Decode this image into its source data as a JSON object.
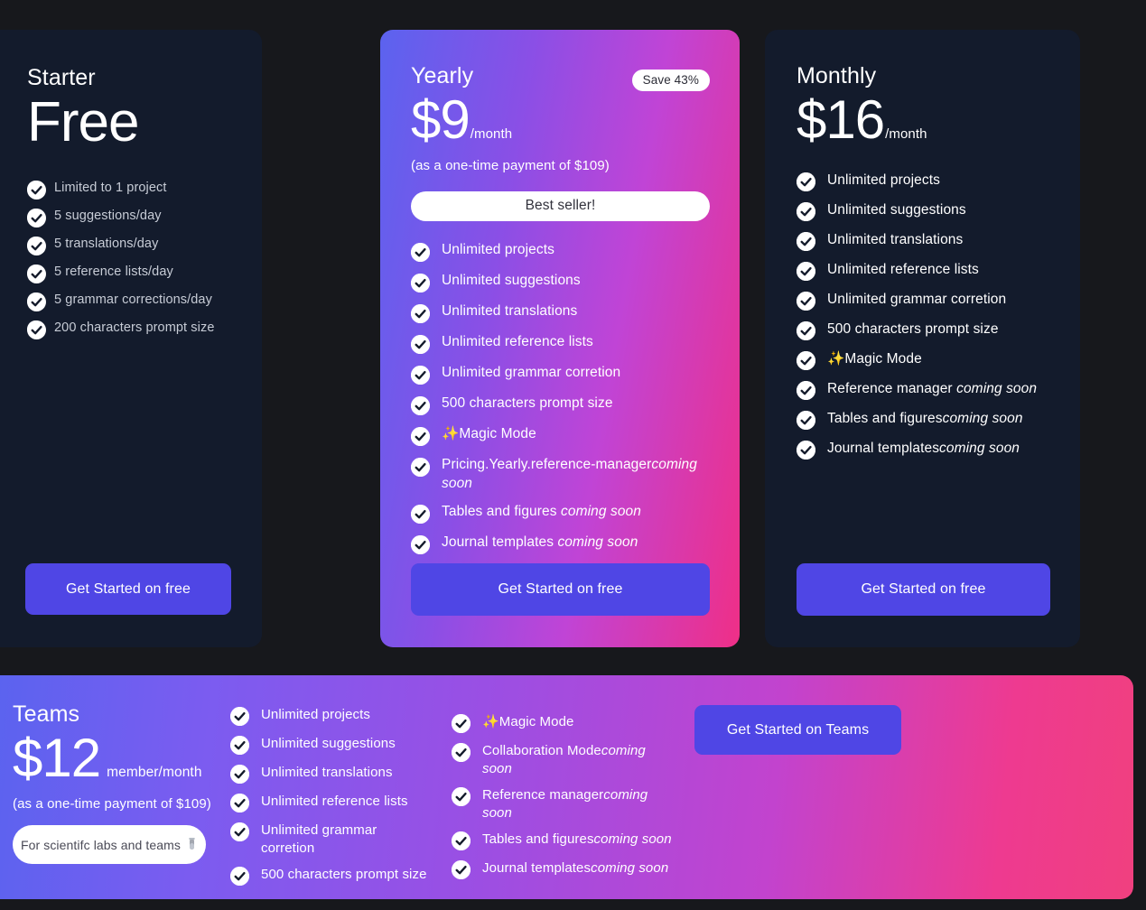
{
  "theme": {
    "page_background": "#17181c",
    "card_background": "#131b2c",
    "accent_button": "#4f46e5",
    "gradient_start": "#5b63ef",
    "gradient_end": "#ef2f87",
    "check_icon": "check-circle-icon"
  },
  "plans": [
    {
      "id": "starter",
      "name": "Starter",
      "price": "Free",
      "per": "",
      "note": "",
      "features": [
        {
          "label": "Limited to 1 project"
        },
        {
          "label": "5 suggestions/day"
        },
        {
          "label": "5 translations/day"
        },
        {
          "label": "5 reference lists/day"
        },
        {
          "label": "5 grammar corrections/day"
        },
        {
          "label": "200 characters prompt size"
        }
      ],
      "cta": "Get Started on free"
    },
    {
      "id": "yearly",
      "name": "Yearly",
      "price": "$9",
      "per": "/month",
      "note": "(as a one-time payment of $109)",
      "badge": "Save 43%",
      "pill": "Best seller!",
      "features": [
        {
          "label": "Unlimited projects"
        },
        {
          "label": "Unlimited suggestions"
        },
        {
          "label": "Unlimited translations"
        },
        {
          "label": "Unlimited reference lists"
        },
        {
          "label": "Unlimited grammar corretion"
        },
        {
          "label": "500 characters prompt size"
        },
        {
          "label": "✨Magic Mode"
        },
        {
          "label": "Pricing.Yearly.reference-manager",
          "soon": "coming soon"
        },
        {
          "label": "Tables and figures ",
          "soon": "coming soon"
        },
        {
          "label": "Journal templates ",
          "soon": "coming soon"
        }
      ],
      "cta": "Get Started on free"
    },
    {
      "id": "monthly",
      "name": "Monthly",
      "price": "$16",
      "per": "/month",
      "note": "",
      "features": [
        {
          "label": "Unlimited projects"
        },
        {
          "label": "Unlimited suggestions"
        },
        {
          "label": "Unlimited translations"
        },
        {
          "label": "Unlimited reference lists"
        },
        {
          "label": "Unlimited grammar corretion"
        },
        {
          "label": "500 characters prompt size"
        },
        {
          "label": "✨Magic Mode"
        },
        {
          "label": "Reference manager ",
          "soon": "coming soon"
        },
        {
          "label": "Tables and figures",
          "soon": "coming soon"
        },
        {
          "label": "Journal templates",
          "soon": "coming soon"
        }
      ],
      "cta": "Get Started on free"
    }
  ],
  "teams": {
    "name": "Teams",
    "price": "$12",
    "per": "member/month",
    "note": "(as a one-time payment of $109)",
    "pill": "For scientifc labs and teams",
    "pill_icon": "test-tube-icon",
    "cta": "Get Started on Teams",
    "features_col1": [
      {
        "label": "Unlimited projects"
      },
      {
        "label": "Unlimited suggestions"
      },
      {
        "label": "Unlimited translations"
      },
      {
        "label": "Unlimited reference lists"
      },
      {
        "label": "Unlimited grammar corretion"
      },
      {
        "label": "500 characters prompt size"
      }
    ],
    "features_col2": [
      {
        "label": "✨Magic Mode"
      },
      {
        "label": "Collaboration Mode",
        "soon": "coming soon"
      },
      {
        "label": "Reference manager",
        "soon": "coming soon"
      },
      {
        "label": "Tables and figures",
        "soon": "coming soon"
      },
      {
        "label": "Journal templates",
        "soon": "coming soon"
      }
    ]
  }
}
